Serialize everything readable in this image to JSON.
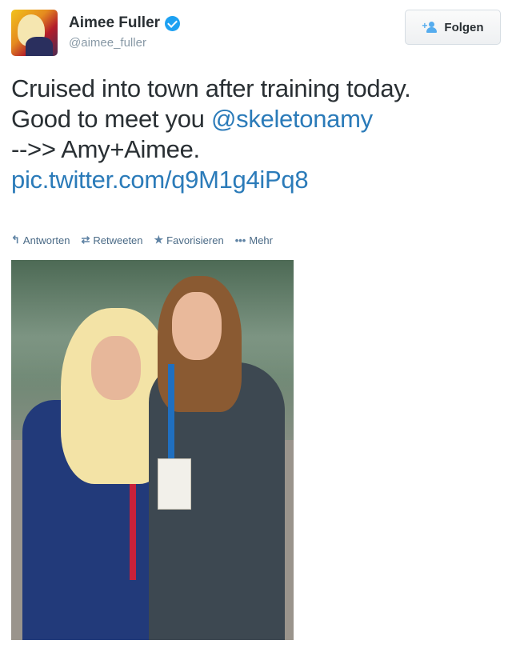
{
  "user": {
    "name": "Aimee Fuller",
    "handle": "@aimee_fuller",
    "verified": true
  },
  "follow_button": {
    "label": "Folgen",
    "icon": "add-user-icon",
    "accent": "#55acee"
  },
  "tweet": {
    "line1": "Cruised into town after training today.",
    "line2_prefix": "Good to meet you ",
    "mention": "@skeletonamy",
    "line3": "-->> Amy+Aimee.",
    "link": "pic.twitter.com/q9M1g4iPq8",
    "link_color": "#2b7bb9"
  },
  "actions": [
    {
      "label": "Antworten",
      "icon": "reply-icon"
    },
    {
      "label": "Retweeten",
      "icon": "retweet-icon"
    },
    {
      "label": "Favorisieren",
      "icon": "star-icon"
    },
    {
      "label": "Mehr",
      "icon": "more-icon"
    }
  ],
  "photo": {
    "icon": "photo-image"
  }
}
